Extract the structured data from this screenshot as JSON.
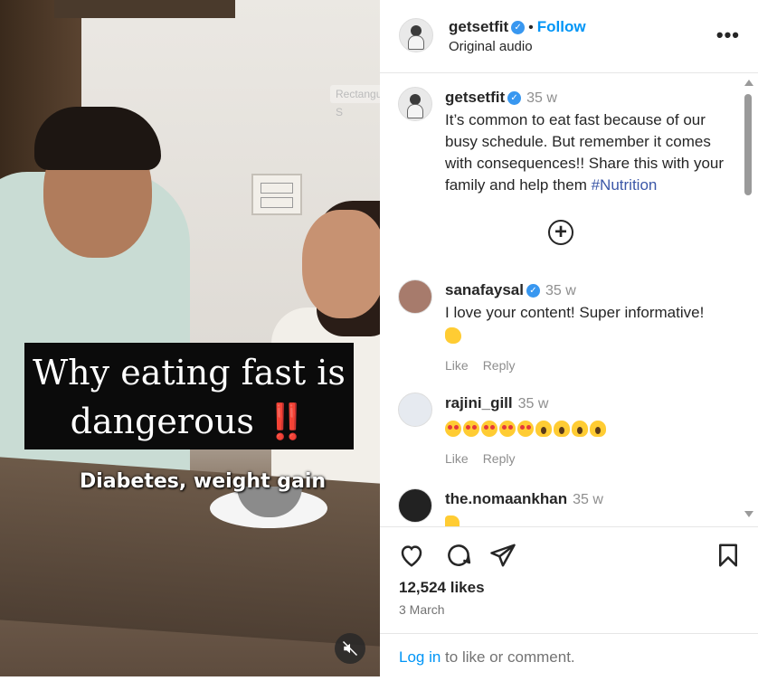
{
  "video": {
    "caption_line1": "Why eating fast is",
    "caption_line2": "dangerous",
    "caption_warn": "‼️",
    "subtitle": "Diabetes, weight gain",
    "ghost_chip": "Rectangular S",
    "mute_icon": "speaker-muted-icon"
  },
  "header": {
    "username": "getsetfit",
    "dot": "•",
    "follow": "Follow",
    "subtitle": "Original audio",
    "more": "•••"
  },
  "caption_post": {
    "username": "getsetfit",
    "time": "35 w",
    "text": "It’s common to eat fast because of our busy schedule. But remember it comes with consequences!! Share this with your family and help them ",
    "hashtag": "#Nutrition"
  },
  "load_more": "+",
  "comments": [
    {
      "username": "sanafaysal",
      "verified": true,
      "time": "35 w",
      "text": "I love your content! Super informative!",
      "emoji": "clap",
      "like": "Like",
      "reply": "Reply"
    },
    {
      "username": "rajini_gill",
      "verified": false,
      "time": "35 w",
      "text": "",
      "emoji": "heart-eyes x5, scream x4",
      "like": "Like",
      "reply": "Reply"
    },
    {
      "username": "the.nomaankhan",
      "verified": false,
      "time": "35 w",
      "text": "",
      "emoji": "thumbs-up"
    }
  ],
  "footer": {
    "likes": "12,524 likes",
    "date": "3 March",
    "login_link": "Log in",
    "login_rest": " to like or comment."
  },
  "colors": {
    "link": "#0095f6",
    "verified": "#3897f0",
    "hashtag": "#3b57a7"
  }
}
